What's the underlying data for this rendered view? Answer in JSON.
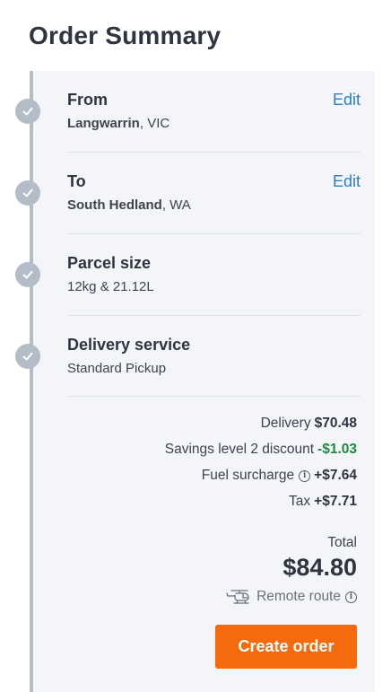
{
  "page": {
    "title": "Order Summary"
  },
  "steps": [
    {
      "title": "From",
      "detail_strong": "Langwarrin",
      "detail_rest": ", VIC",
      "edit_label": "Edit"
    },
    {
      "title": "To",
      "detail_strong": "South Hedland",
      "detail_rest": ", WA",
      "edit_label": "Edit"
    },
    {
      "title": "Parcel size",
      "detail": "12kg & 21.12L"
    },
    {
      "title": "Delivery service",
      "detail": "Standard Pickup"
    }
  ],
  "pricing": {
    "delivery": {
      "label": "Delivery",
      "amount": "$70.48"
    },
    "discount": {
      "label": "Savings level 2 discount",
      "amount": "-$1.03"
    },
    "fuel": {
      "label": "Fuel surcharge",
      "amount": "+$7.64"
    },
    "tax": {
      "label": "Tax",
      "amount": "+$7.71"
    },
    "total_label": "Total",
    "total_value": "$84.80",
    "remote_label": "Remote route"
  },
  "actions": {
    "create_order": "Create order"
  },
  "colors": {
    "accent": "#f46a0c",
    "link": "#2a7fc1",
    "discount": "#1f8a3e",
    "timeline": "#b4bcc8"
  },
  "icons": {
    "step": "check-icon",
    "info": "info-icon",
    "remote": "helicopter-icon"
  }
}
